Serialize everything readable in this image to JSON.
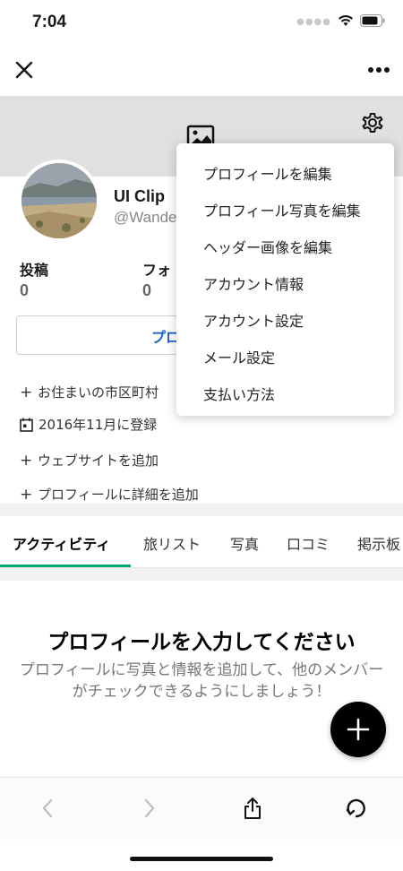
{
  "status_bar": {
    "time": "7:04"
  },
  "nav": {
    "close_icon": "close-icon",
    "more_icon": "more-icon"
  },
  "profile": {
    "name": "UI Clip",
    "handle": "@Wande",
    "stats": [
      {
        "label": "投稿",
        "value": "0"
      },
      {
        "label": "フォ",
        "value": "0"
      }
    ],
    "edit_button_label": "プロフ",
    "info_rows": [
      {
        "icon": "plus-icon",
        "text": "お住まいの市区町村"
      },
      {
        "icon": "calendar-icon",
        "text": "2016年11月に登録"
      },
      {
        "icon": "plus-icon",
        "text": "ウェブサイトを追加"
      },
      {
        "icon": "plus-icon",
        "text": "プロフィールに詳細を追加"
      }
    ]
  },
  "tabs": [
    {
      "label": "アクティビティ",
      "active": true
    },
    {
      "label": "旅リスト",
      "active": false
    },
    {
      "label": "写真",
      "active": false
    },
    {
      "label": "口コミ",
      "active": false
    },
    {
      "label": "掲示板",
      "active": false
    }
  ],
  "empty_state": {
    "title": "プロフィールを入力してください",
    "description": "プロフィールに写真と情報を追加して、他のメンバーがチェックできるようにしましょう！"
  },
  "dropdown": {
    "items": [
      "プロフィールを編集",
      "プロフィール写真を編集",
      "ヘッダー画像を編集",
      "アカウント情報",
      "アカウント設定",
      "メール設定",
      "支払い方法"
    ]
  },
  "colors": {
    "accent_green": "#00aa6c",
    "link_blue": "#1763d1"
  }
}
